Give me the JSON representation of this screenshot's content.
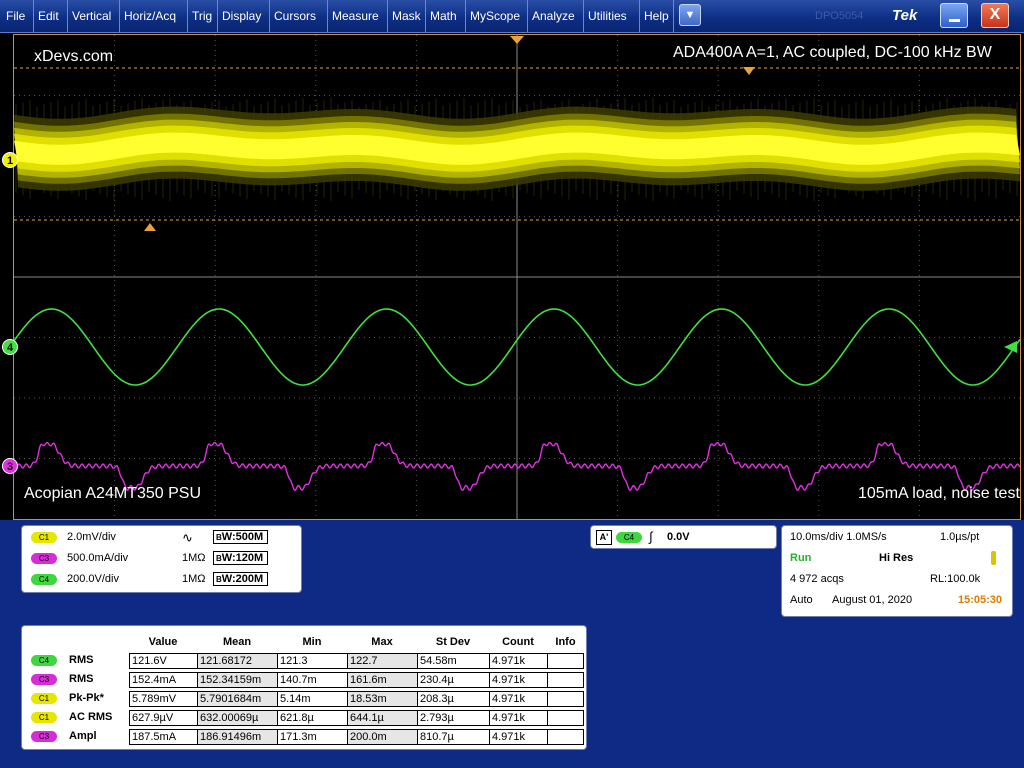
{
  "menu": {
    "items": [
      "File",
      "Edit",
      "Vertical",
      "Horiz/Acq",
      "Trig",
      "Display",
      "Cursors",
      "Measure",
      "Mask",
      "Math",
      "MyScope",
      "Analyze",
      "Utilities",
      "Help"
    ],
    "dropdown_icon": "down-triangle-icon",
    "ghost_text": "DPO5054",
    "brand": "Tek",
    "close_label": "X"
  },
  "graticule": {
    "top_left": "xDevs.com",
    "top_right": "ADA400A A=1, AC coupled, DC-100 kHz BW",
    "bottom_left": "Acopian A24MT350 PSU",
    "bottom_right": "105mA load, noise test",
    "markers": {
      "ch1": "1",
      "ch4": "4",
      "ch3": "3"
    },
    "colors": {
      "ch1": "#f0f000",
      "ch4": "#3fe03f",
      "ch3": "#e030e0",
      "grid": "#5a5a5a",
      "cursor": "#e8a33a"
    }
  },
  "channels": [
    {
      "badge": "C1",
      "scale": "2.0mV/div",
      "coupling": "",
      "bw": "500M",
      "color": "yellow"
    },
    {
      "badge": "C3",
      "scale": "500.0mA/div",
      "coupling": "1MΩ",
      "bw": "120M",
      "color": "magenta"
    },
    {
      "badge": "C4",
      "scale": "200.0V/div",
      "coupling": "1MΩ",
      "bw": "200M",
      "color": "green"
    }
  ],
  "trigger": {
    "a": "A'",
    "badge": "C4",
    "level": "0.0V"
  },
  "acquisition": {
    "timebase": "10.0ms/div 1.0MS/s",
    "resolution": "1.0µs/pt",
    "state": "Run",
    "mode": "Hi Res",
    "acqs": "4 972 acqs",
    "record": "RL:100.0k",
    "trigger_mode": "Auto",
    "date": "August 01, 2020",
    "time": "15:05:30"
  },
  "measurements": {
    "headers": [
      "Value",
      "Mean",
      "Min",
      "Max",
      "St Dev",
      "Count",
      "Info"
    ],
    "rows": [
      {
        "badge": "C4",
        "color": "green",
        "name": "RMS",
        "value": "121.6V",
        "mean": "121.68172",
        "min": "121.3",
        "max": "122.7",
        "stdev": "54.58m",
        "count": "4.971k",
        "info": ""
      },
      {
        "badge": "C3",
        "color": "magenta",
        "name": "RMS",
        "value": "152.4mA",
        "mean": "152.34159m",
        "min": "140.7m",
        "max": "161.6m",
        "stdev": "230.4µ",
        "count": "4.971k",
        "info": ""
      },
      {
        "badge": "C1",
        "color": "yellow",
        "name": "Pk-Pk*",
        "value": "5.789mV",
        "mean": "5.7901684m",
        "min": "5.14m",
        "max": "18.53m",
        "stdev": "208.3µ",
        "count": "4.971k",
        "info": ""
      },
      {
        "badge": "C1",
        "color": "yellow",
        "name": "AC RMS",
        "value": "627.9µV",
        "mean": "632.00069µ",
        "min": "621.8µ",
        "max": "644.1µ",
        "stdev": "2.793µ",
        "count": "4.971k",
        "info": ""
      },
      {
        "badge": "C3",
        "color": "magenta",
        "name": "Ampl",
        "value": "187.5mA",
        "mean": "186.91496m",
        "min": "171.3m",
        "max": "200.0m",
        "stdev": "810.7µ",
        "count": "4.971k",
        "info": ""
      }
    ]
  }
}
